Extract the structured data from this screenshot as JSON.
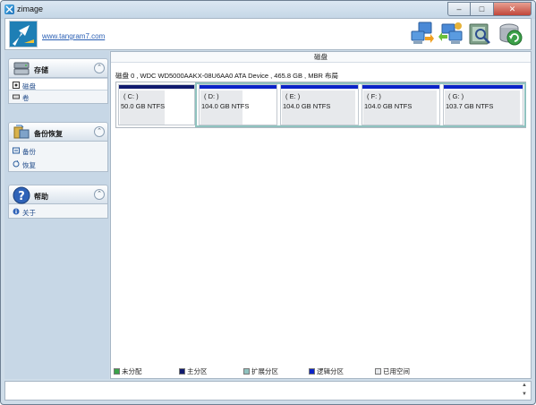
{
  "window": {
    "title": "zimage"
  },
  "header": {
    "link": "www.tangram7.com"
  },
  "sidebar": {
    "groups": [
      {
        "title": "存储",
        "items": [
          {
            "label": "磁盘",
            "selected": true
          },
          {
            "label": "卷",
            "selected": false
          }
        ]
      },
      {
        "title": "备份恢复",
        "items": [
          {
            "label": "备份"
          },
          {
            "label": "恢复"
          }
        ]
      },
      {
        "title": "帮助",
        "items": [
          {
            "label": "关于"
          }
        ]
      }
    ]
  },
  "main": {
    "title": "磁盘",
    "disk_info": "磁盘 0 , WDC WD5000AAKX-08U6AA0 ATA Device , 465.8 GB , MBR 布局",
    "partitions": [
      {
        "name": "( C: )",
        "size": "50.0 GB NTFS",
        "type": "primary",
        "used": 0.6
      },
      {
        "name": "( D: )",
        "size": "104.0 GB NTFS",
        "type": "logical",
        "used": 0.55
      },
      {
        "name": "( E: )",
        "size": "104.0 GB NTFS",
        "type": "logical",
        "used": 0.95
      },
      {
        "name": "( F: )",
        "size": "104.0 GB NTFS",
        "type": "logical",
        "used": 0.95
      },
      {
        "name": "( G: )",
        "size": "103.7 GB NTFS",
        "type": "logical",
        "used": 0.95
      }
    ],
    "legend": [
      {
        "label": "未分配",
        "color": "#3aa34a"
      },
      {
        "label": "主分区",
        "color": "#101a6e"
      },
      {
        "label": "扩展分区",
        "color": "#8fc2bf"
      },
      {
        "label": "逻辑分区",
        "color": "#0a23c8"
      },
      {
        "label": "已用空间",
        "color": "#e7e9ec"
      }
    ]
  },
  "colors": {
    "primary": "#101a6e",
    "logical": "#0a23c8",
    "extended": "#8fc2bf",
    "accent": "#2a5fb4"
  }
}
